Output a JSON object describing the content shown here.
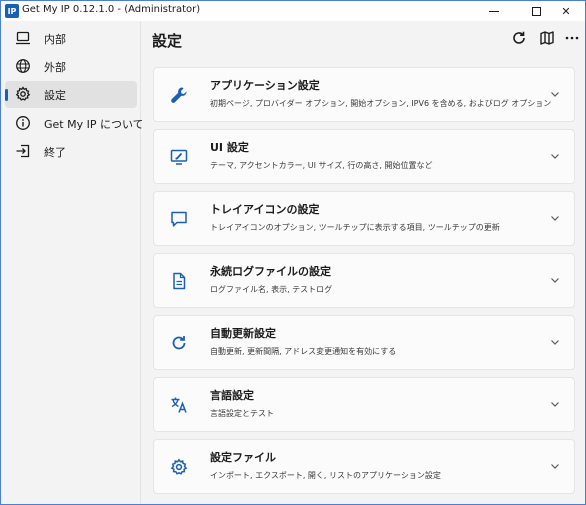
{
  "window": {
    "app_icon_text": "IP",
    "title": "Get My IP  0.12.1.0 - (Administrator)",
    "close_glyph": "✕"
  },
  "sidebar": {
    "items": [
      {
        "label": "内部",
        "icon": "computer-icon",
        "active": false
      },
      {
        "label": "外部",
        "icon": "globe-icon",
        "active": false
      },
      {
        "label": "設定",
        "icon": "gear-icon",
        "active": true
      },
      {
        "label": "Get My IP について",
        "icon": "info-icon",
        "active": false
      },
      {
        "label": "終了",
        "icon": "exit-icon",
        "active": false
      }
    ]
  },
  "main": {
    "title": "設定",
    "toolbar": [
      "refresh-icon",
      "map-icon",
      "more-icon"
    ],
    "cards": [
      {
        "title": "アプリケーション設定",
        "desc": "初期ページ, プロバイダー オプション, 開始オプション, IPV6 を含める, およびログ オプション",
        "icon": "wrench-icon"
      },
      {
        "title": "UI 設定",
        "desc": "テーマ, アクセントカラー, UI サイズ, 行の高さ, 開始位置など",
        "icon": "monitor-brush-icon"
      },
      {
        "title": "トレイアイコンの設定",
        "desc": "トレイアイコンのオプション, ツールチップに表示する項目, ツールチップの更新",
        "icon": "comment-icon"
      },
      {
        "title": "永続ログファイルの設定",
        "desc": "ログファイル名, 表示, テストログ",
        "icon": "document-icon"
      },
      {
        "title": "自動更新設定",
        "desc": "自動更新, 更新間隔, アドレス変更通知を有効にする",
        "icon": "refresh-icon"
      },
      {
        "title": "言語設定",
        "desc": "言語設定とテスト",
        "icon": "translate-icon"
      },
      {
        "title": "設定ファイル",
        "desc": "インポート, エクスポート, 開く, リストのアプリケーション設定",
        "icon": "settings-cog-icon"
      }
    ]
  },
  "colors": {
    "accent": "#1a5fb4",
    "background": "#f3f3f3",
    "card": "#fbfbfb"
  }
}
